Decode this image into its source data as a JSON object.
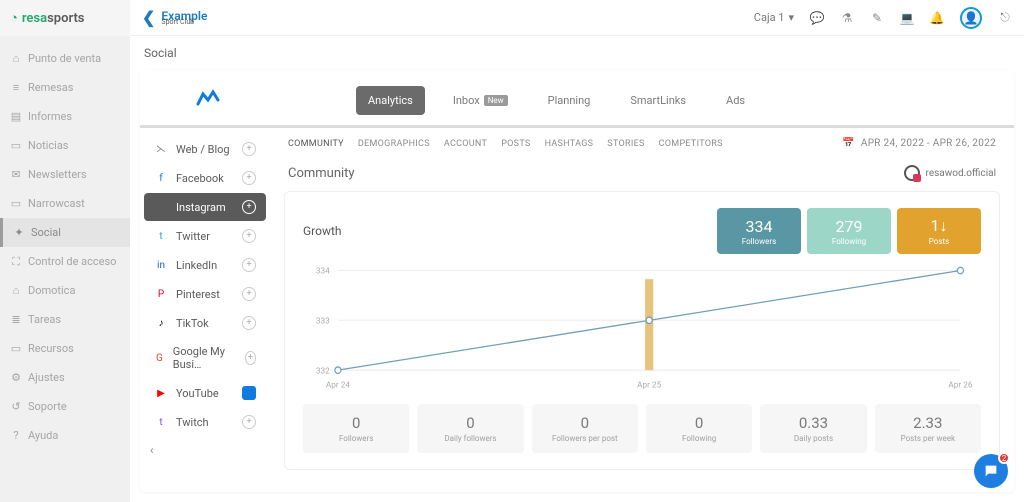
{
  "brand": {
    "name1": "resa",
    "name2": "sports"
  },
  "topbar": {
    "caja": "Caja 1",
    "org": "Example",
    "org_sub": "Sport Club"
  },
  "page_title": "Social",
  "left_nav": {
    "items": [
      {
        "icon": "⌂",
        "label": "Punto de venta"
      },
      {
        "icon": "≡",
        "label": "Remesas"
      },
      {
        "icon": "▤",
        "label": "Informes"
      },
      {
        "icon": "▭",
        "label": "Noticias"
      },
      {
        "icon": "✉",
        "label": "Newsletters"
      },
      {
        "icon": "▭",
        "label": "Narrowcast"
      },
      {
        "icon": "✦",
        "label": "Social"
      },
      {
        "icon": "⛶",
        "label": "Control de acceso"
      },
      {
        "icon": "⌂",
        "label": "Domotica"
      },
      {
        "icon": "≣",
        "label": "Tareas"
      },
      {
        "icon": "▭",
        "label": "Recursos"
      },
      {
        "icon": "⚙",
        "label": "Ajustes"
      },
      {
        "icon": "↺",
        "label": "Soporte"
      },
      {
        "icon": "?",
        "label": "Ayuda"
      }
    ]
  },
  "dash_tabs": [
    "Analytics",
    "Inbox",
    "Planning",
    "SmartLinks",
    "Ads"
  ],
  "inbox_new": "New",
  "channels": [
    {
      "label": "Web / Blog",
      "color": "#888",
      "icon": "⋋"
    },
    {
      "label": "Facebook",
      "color": "#1877f2",
      "icon": "f"
    },
    {
      "label": "Instagram",
      "color": "#5a5a5a",
      "icon": "◎",
      "active": true
    },
    {
      "label": "Twitter",
      "color": "#1da1f2",
      "icon": "t"
    },
    {
      "label": "LinkedIn",
      "color": "#0a66c2",
      "icon": "in"
    },
    {
      "label": "Pinterest",
      "color": "#e60023",
      "icon": "P"
    },
    {
      "label": "TikTok",
      "color": "#000",
      "icon": "♪"
    },
    {
      "label": "Google My Busi…",
      "color": "#ea4335",
      "icon": "G"
    },
    {
      "label": "YouTube",
      "color": "#ff0000",
      "icon": "▶",
      "badge": true
    },
    {
      "label": "Twitch",
      "color": "#9146ff",
      "icon": "t"
    }
  ],
  "subtabs": [
    "COMMUNITY",
    "DEMOGRAPHICS",
    "ACCOUNT",
    "POSTS",
    "HASHTAGS",
    "STORIES",
    "COMPETITORS"
  ],
  "date_range": "APR 24, 2022 - APR 26, 2022",
  "section_title": "Community",
  "account": "resawod.official",
  "growth": {
    "title": "Growth",
    "cards": [
      {
        "num": "334",
        "label": "Followers",
        "cls": "sc-teal"
      },
      {
        "num": "279",
        "label": "Following",
        "cls": "sc-mint"
      },
      {
        "num": "1↓",
        "label": "Posts",
        "cls": "sc-amber"
      }
    ],
    "mini": [
      {
        "v": "0",
        "l": "Followers"
      },
      {
        "v": "0",
        "l": "Daily followers"
      },
      {
        "v": "0",
        "l": "Followers per post"
      },
      {
        "v": "0",
        "l": "Following"
      },
      {
        "v": "0.33",
        "l": "Daily posts"
      },
      {
        "v": "2.33",
        "l": "Posts per week"
      }
    ]
  },
  "chart_data": {
    "type": "line",
    "categories": [
      "Apr 24",
      "Apr 25",
      "Apr 26"
    ],
    "values": [
      332,
      333,
      334
    ],
    "y_ticks": [
      332,
      333,
      334
    ],
    "ylim": [
      332,
      334
    ],
    "highlight_index": 1
  },
  "chat_badge": "2"
}
